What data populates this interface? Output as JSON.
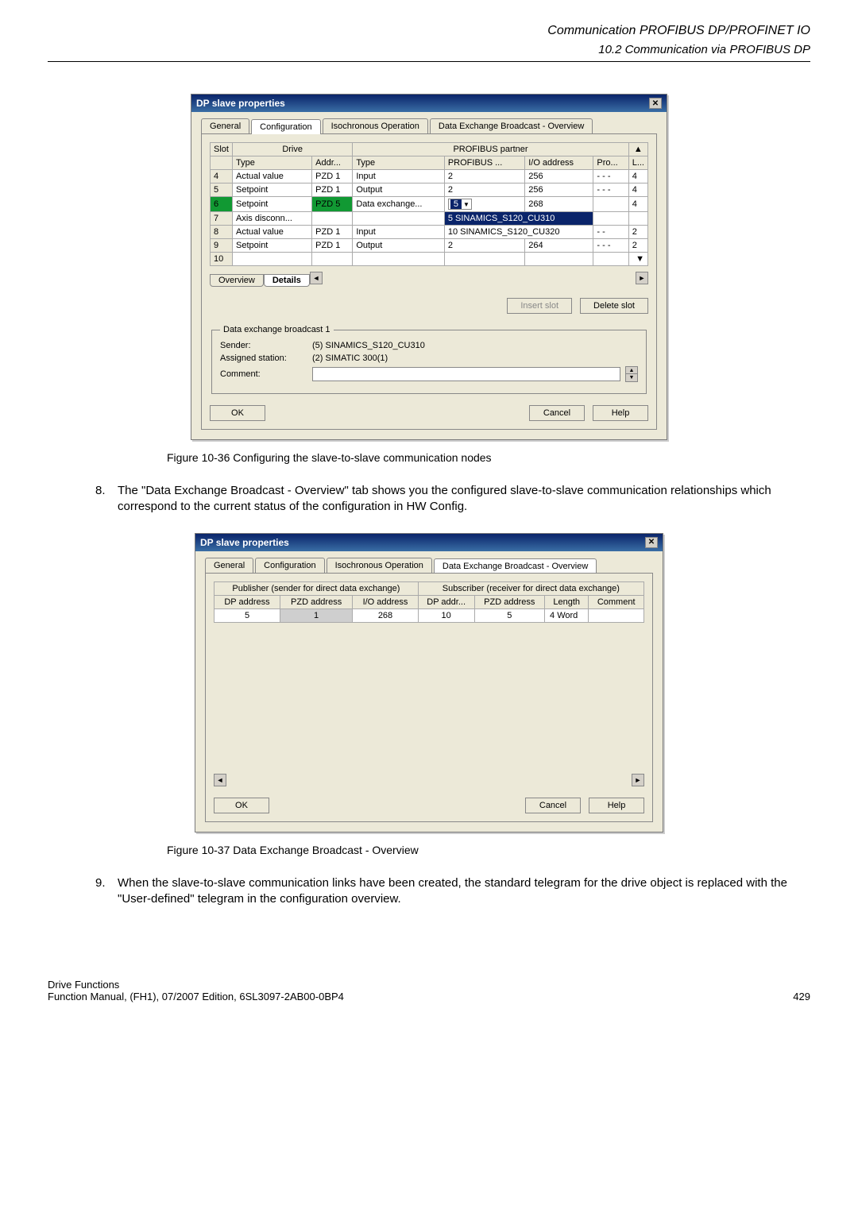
{
  "header": {
    "line1": "Communication PROFIBUS DP/PROFINET IO",
    "line2": "10.2 Communication via PROFIBUS DP"
  },
  "dialog1": {
    "title": "DP slave properties",
    "tabs": [
      "General",
      "Configuration",
      "Isochronous Operation",
      "Data Exchange Broadcast - Overview"
    ],
    "active_tab": 1,
    "group_headers": {
      "slot": "Slot",
      "drive": "Drive",
      "partner": "PROFIBUS partner"
    },
    "col_headers": [
      "Type",
      "Addr...",
      "Type",
      "PROFIBUS ...",
      "I/O address",
      "Pro...",
      "L..."
    ],
    "rows": [
      {
        "slot": "4",
        "dtype": "Actual value",
        "addr": "PZD 1",
        "ptype": "Input",
        "pb": "2",
        "io": "256",
        "pro": "- - -",
        "l": "4",
        "green_slot": false
      },
      {
        "slot": "5",
        "dtype": "Setpoint",
        "addr": "PZD 1",
        "ptype": "Output",
        "pb": "2",
        "io": "256",
        "pro": "- - -",
        "l": "4",
        "green_slot": false
      },
      {
        "slot": "6",
        "dtype": "Setpoint",
        "addr": "PZD 5",
        "ptype": "Data exchange...",
        "pb": "5",
        "io": "268",
        "pro": "",
        "l": "4",
        "green_slot": true,
        "pb_dropdown": true
      },
      {
        "slot": "7",
        "dtype": "Axis disconn...",
        "addr": "",
        "ptype": "",
        "pb": "5 SINAMICS_S120_CU310",
        "io": "",
        "pro": "",
        "l": "",
        "hl_row": true
      },
      {
        "slot": "8",
        "dtype": "Actual value",
        "addr": "PZD 1",
        "ptype": "Input",
        "pb": "10 SINAMICS_S120_CU320",
        "io": "",
        "pro": "- -",
        "l": "2"
      },
      {
        "slot": "9",
        "dtype": "Setpoint",
        "addr": "PZD 1",
        "ptype": "Output",
        "pb": "2",
        "io": "264",
        "pro": "- - -",
        "l": "2"
      },
      {
        "slot": "10",
        "dtype": "",
        "addr": "",
        "ptype": "",
        "pb": "",
        "io": "",
        "pro": "",
        "l": ""
      }
    ],
    "sheet_tabs": {
      "overview": "Overview",
      "details": "Details"
    },
    "insert_btn": "Insert slot",
    "delete_btn": "Delete slot",
    "broadcast": {
      "legend": "Data exchange broadcast 1",
      "sender_k": "Sender:",
      "sender_v": "(5) SINAMICS_S120_CU310",
      "station_k": "Assigned station:",
      "station_v": "(2) SIMATIC 300(1)",
      "comment_k": "Comment:",
      "comment_v": ""
    },
    "ok": "OK",
    "cancel": "Cancel",
    "help": "Help"
  },
  "caption1": "Figure 10-36  Configuring the slave-to-slave communication nodes",
  "para8_num": "8.",
  "para8_text": "The \"Data Exchange Broadcast - Overview\" tab shows you the configured slave-to-slave communication relationships which correspond to the current status of the configuration in HW Config.",
  "dialog2": {
    "title": "DP slave properties",
    "tabs": [
      "General",
      "Configuration",
      "Isochronous Operation",
      "Data Exchange Broadcast - Overview"
    ],
    "active_tab": 3,
    "pub_header": "Publisher (sender for direct data exchange)",
    "sub_header": "Subscriber (receiver for direct data exchange)",
    "pub_cols": [
      "DP address",
      "PZD address",
      "I/O address"
    ],
    "sub_cols": [
      "DP addr...",
      "PZD address",
      "Length",
      "Comment"
    ],
    "row": {
      "dp1": "5",
      "pzd1": "1",
      "io1": "268",
      "dp2": "10",
      "pzd2": "5",
      "len": "4 Word",
      "comment": ""
    },
    "ok": "OK",
    "cancel": "Cancel",
    "help": "Help"
  },
  "caption2": "Figure 10-37  Data Exchange Broadcast - Overview",
  "para9_num": "9.",
  "para9_text": "When the slave-to-slave communication links have been created, the standard telegram for the drive object is replaced with the \"User-defined\" telegram in the configuration overview.",
  "footer": {
    "left1": "Drive Functions",
    "left2": "Function Manual, (FH1), 07/2007 Edition, 6SL3097-2AB00-0BP4",
    "right": "429"
  }
}
